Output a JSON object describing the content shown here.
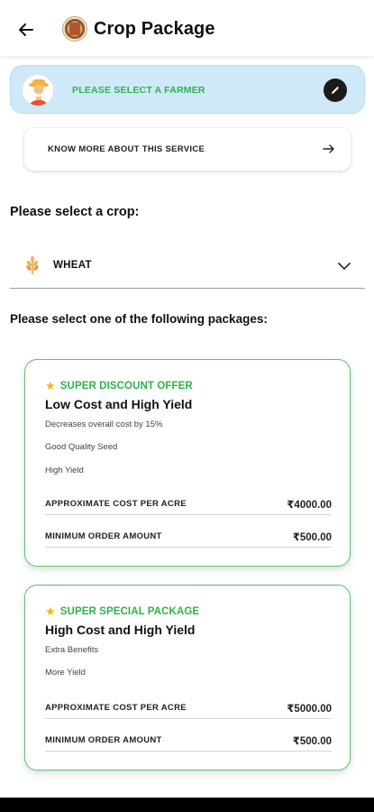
{
  "header": {
    "title": "Crop Package",
    "back_icon": "arrow-left-icon",
    "logo_icon": "app-logo-icon"
  },
  "farmer": {
    "label": "PLEASE SELECT A FARMER",
    "avatar_icon": "farmer-avatar-icon",
    "edit_icon": "pencil-icon"
  },
  "service": {
    "label": "KNOW MORE ABOUT THIS SERVICE",
    "arrow_icon": "arrow-right-icon"
  },
  "crop": {
    "heading": "Please select a crop:",
    "selected": "WHEAT",
    "crop_icon": "wheat-icon",
    "dropdown_icon": "chevron-down-icon"
  },
  "packages": {
    "heading": "Please select one of the following packages:",
    "items": [
      {
        "tag": "SUPER DISCOUNT OFFER",
        "title": "Low Cost and High Yield",
        "benefits": [
          "Decreases overall cost by 15%",
          "Good Quality Seed",
          "High Yield"
        ],
        "cost_label": "APPROXIMATE COST PER ACRE",
        "cost_value": "₹4000.00",
        "min_label": "MINIMUM ORDER AMOUNT",
        "min_value": "₹500.00"
      },
      {
        "tag": "SUPER SPECIAL PACKAGE",
        "title": "High Cost and High Yield",
        "benefits": [
          "Extra Benefits",
          "More Yield"
        ],
        "cost_label": "APPROXIMATE COST PER ACRE",
        "cost_value": "₹5000.00",
        "min_label": "MINIMUM ORDER AMOUNT",
        "min_value": "₹500.00"
      }
    ]
  },
  "colors": {
    "accent_green": "#2db34a",
    "farmer_bar_bg": "#cfe9f9",
    "card_border": "#58c36f",
    "star": "#f5b800"
  }
}
